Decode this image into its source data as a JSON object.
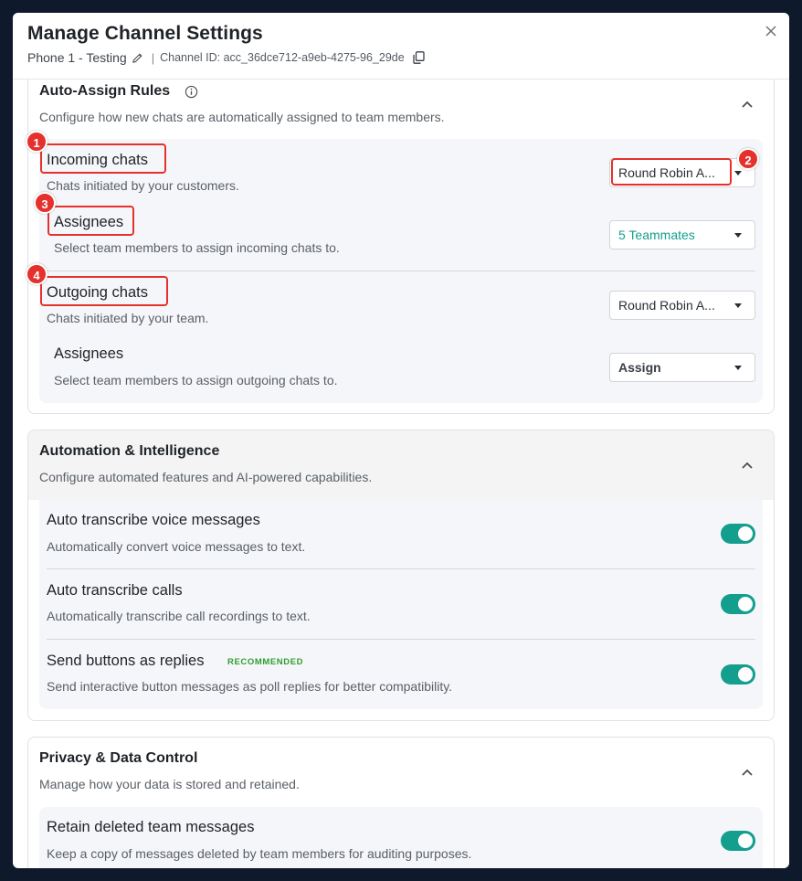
{
  "modal": {
    "title": "Manage Channel Settings",
    "phone_name": "Phone 1 - Testing",
    "separator": "|",
    "channel_id": "Channel ID: acc_36dce712-a9eb-4275-96_29de"
  },
  "auto_assign": {
    "title": "Auto-Assign Rules",
    "desc": "Configure how new chats are automatically assigned to team members.",
    "incoming": {
      "title": "Incoming chats",
      "desc": "Chats initiated by your customers.",
      "select_value": "Round Robin A...",
      "assignees_title": "Assignees",
      "assignees_desc": "Select team members to assign incoming chats to.",
      "assignees_value": "5 Teammates"
    },
    "outgoing": {
      "title": "Outgoing chats",
      "desc": "Chats initiated by your team.",
      "select_value": "Round Robin A...",
      "assignees_title": "Assignees",
      "assignees_desc": "Select team members to assign outgoing chats to.",
      "assignees_value": "Assign"
    }
  },
  "automation": {
    "title": "Automation & Intelligence",
    "desc": "Configure automated features and AI-powered capabilities.",
    "items": [
      {
        "title": "Auto transcribe voice messages",
        "desc": "Automatically convert voice messages to text.",
        "enabled": true
      },
      {
        "title": "Auto transcribe calls",
        "desc": "Automatically transcribe call recordings to text.",
        "enabled": true
      },
      {
        "title": "Send buttons as replies",
        "badge": "RECOMMENDED",
        "desc": "Send interactive button messages as poll replies for better compatibility.",
        "enabled": true
      }
    ]
  },
  "privacy": {
    "title": "Privacy & Data Control",
    "desc": "Manage how your data is stored and retained.",
    "items": [
      {
        "title": "Retain deleted team messages",
        "desc": "Keep a copy of messages deleted by team members for auditing purposes.",
        "enabled": true
      }
    ]
  },
  "markers": [
    "1",
    "2",
    "3",
    "4"
  ],
  "colors": {
    "accent": "#149e8e",
    "highlight": "#e5312d",
    "backdrop": "#0e1a2c",
    "recommended": "#2f9e2f"
  },
  "icons": [
    "pencil-icon",
    "copy-icon",
    "close-icon",
    "info-icon",
    "chevron-up-icon",
    "caret-down-icon"
  ]
}
